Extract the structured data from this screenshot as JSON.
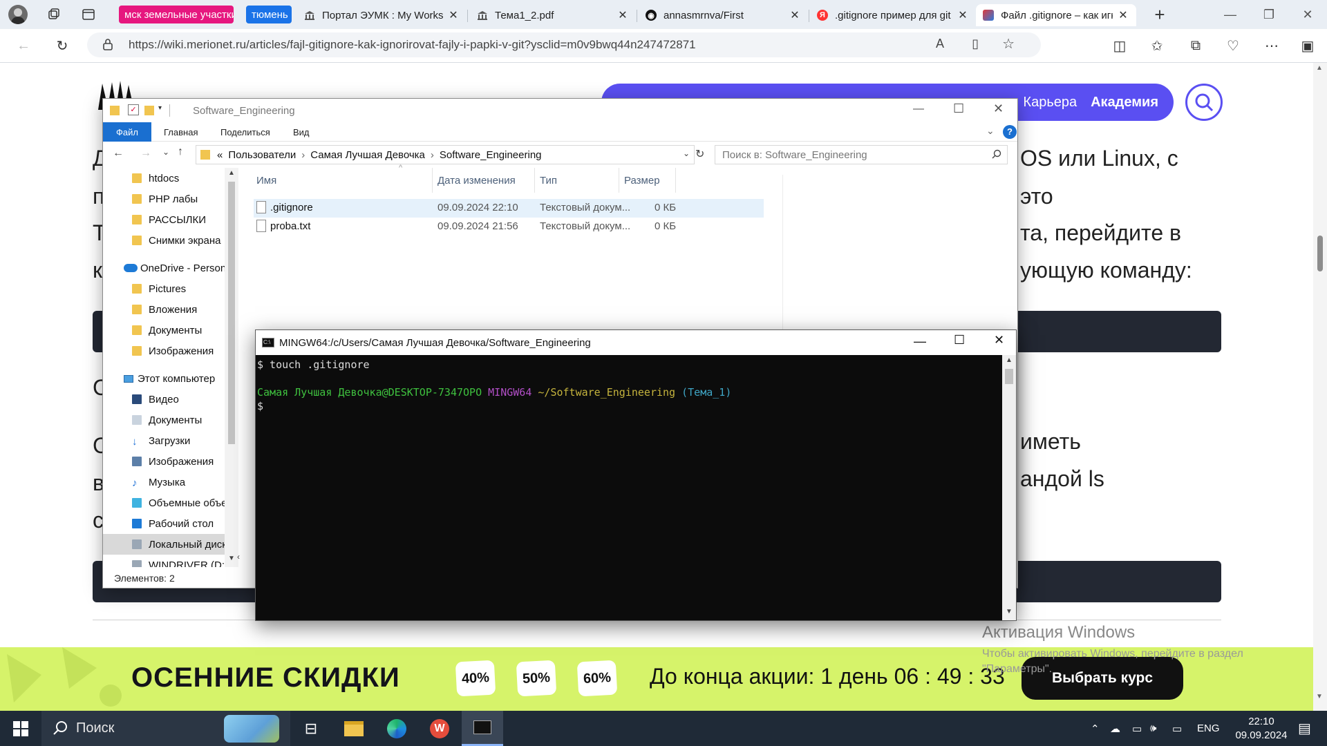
{
  "browser": {
    "pinned_pills": [
      {
        "label": "мск земельные участки",
        "color": "#e6177f"
      },
      {
        "label": "тюмень",
        "color": "#1a73e8"
      }
    ],
    "tabs": [
      {
        "title": "Портал ЭУМК : My Workspace",
        "icon": "bank-icon"
      },
      {
        "title": "Тема1_2.pdf",
        "icon": "bank-icon"
      },
      {
        "title": "annasmrnva/First",
        "icon": "github-icon"
      },
      {
        "title": ".gitignore пример для git",
        "icon": "yandex-icon"
      },
      {
        "title": "Файл .gitignore – как игнорировать",
        "icon": "merionet-icon",
        "active": true
      }
    ],
    "url": "https://wiki.merionet.ru/articles/fajl-gitignore-kak-ignorirovat-fajly-i-papki-v-git?ysclid=m0v9bwq44n247472871"
  },
  "page": {
    "menu_items": [
      "Карьера",
      "Академия"
    ],
    "fragments": [
      "OS или Linux, с",
      "это",
      "та, перейдите в",
      "ующую команду:",
      "иметь",
      "андой ls"
    ],
    "left_letters": [
      "Д",
      "п",
      "Т",
      "к",
      "С",
      "С",
      "в",
      "с"
    ]
  },
  "banner": {
    "title": "ОСЕННИЕ СКИДКИ",
    "discounts": [
      "40%",
      "50%",
      "60%"
    ],
    "countdown": "До конца акции: 1 день 06 : 49 : 33",
    "button": "Выбрать курс"
  },
  "activation": {
    "title": "Активация Windows",
    "subtitle_line1": "Чтобы активировать Windows, перейдите в раздел",
    "subtitle_line2": "\"Параметры\"."
  },
  "explorer": {
    "title": "Software_Engineering",
    "ribbon_tabs": [
      "Файл",
      "Главная",
      "Поделиться",
      "Вид"
    ],
    "path": [
      "«",
      "Пользователи",
      "Самая Лучшая Девочка",
      "Software_Engineering"
    ],
    "search_placeholder": "Поиск в: Software_Engineering",
    "nav": [
      {
        "label": "htdocs",
        "icon": "folder-icon"
      },
      {
        "label": "PHP лабы",
        "icon": "folder-icon"
      },
      {
        "label": "РАССЫЛКИ",
        "icon": "folder-icon"
      },
      {
        "label": "Снимки экрана",
        "icon": "folder-icon"
      },
      {
        "label": "OneDrive - Personal",
        "icon": "onedrive-icon"
      },
      {
        "label": "Pictures",
        "icon": "folder-icon"
      },
      {
        "label": "Вложения",
        "icon": "folder-icon"
      },
      {
        "label": "Документы",
        "icon": "folder-icon"
      },
      {
        "label": "Изображения",
        "icon": "folder-icon"
      },
      {
        "label": "Этот компьютер",
        "icon": "computer-icon"
      },
      {
        "label": "Видео",
        "icon": "video-icon"
      },
      {
        "label": "Документы",
        "icon": "documents-icon"
      },
      {
        "label": "Загрузки",
        "icon": "downloads-icon"
      },
      {
        "label": "Изображения",
        "icon": "pictures-icon"
      },
      {
        "label": "Музыка",
        "icon": "music-icon"
      },
      {
        "label": "Объемные объекты",
        "icon": "3d-objects-icon"
      },
      {
        "label": "Рабочий стол",
        "icon": "desktop-icon"
      },
      {
        "label": "Локальный диск",
        "icon": "drive-icon"
      },
      {
        "label": "WINDRIVER (D:)",
        "icon": "drive-icon"
      }
    ],
    "columns": [
      "Имя",
      "Дата изменения",
      "Тип",
      "Размер"
    ],
    "files": [
      {
        "name": ".gitignore",
        "date": "09.09.2024 22:10",
        "type": "Текстовый докум...",
        "size": "0 КБ"
      },
      {
        "name": "proba.txt",
        "date": "09.09.2024 21:56",
        "type": "Текстовый докум...",
        "size": "0 КБ"
      }
    ],
    "status": "Элементов: 2"
  },
  "terminal": {
    "title": "MINGW64:/c/Users/Самая Лучшая Девочка/Software_Engineering",
    "command_line": "$ touch .gitignore",
    "prompt_user": "Самая Лучшая Девочка@DESKTOP-7347OPO",
    "prompt_env": "MINGW64",
    "prompt_path": "~/Software_Engineering",
    "prompt_branch": "(Тема_1)",
    "cursor_line": "$"
  },
  "taskbar": {
    "search_label": "Поиск",
    "language": "ENG",
    "time": "22:10",
    "date": "09.09.2024"
  },
  "colors": {
    "accent_purple": "#5a4ff2",
    "banner_green": "#d6f36a",
    "term_green": "#3fc13f",
    "term_magenta": "#b14fc6",
    "term_yellow": "#c6b43d",
    "term_cyan": "#3fa6c6"
  }
}
